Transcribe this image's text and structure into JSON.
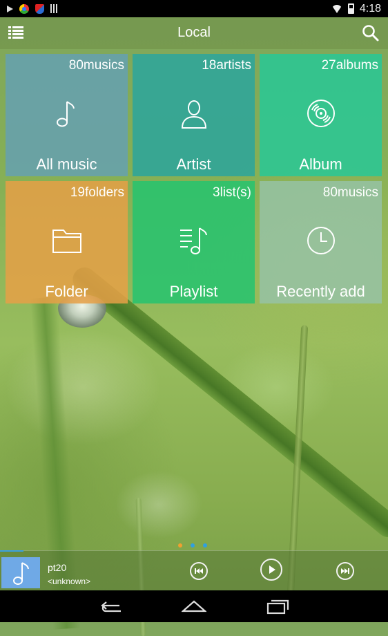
{
  "statusbar": {
    "time": "4:18"
  },
  "header": {
    "title": "Local"
  },
  "tiles": [
    {
      "count": "80musics",
      "label": "All music",
      "icon": "music-note-icon"
    },
    {
      "count": "18artists",
      "label": "Artist",
      "icon": "person-icon"
    },
    {
      "count": "27albums",
      "label": "Album",
      "icon": "disc-icon"
    },
    {
      "count": "19folders",
      "label": "Folder",
      "icon": "folder-icon"
    },
    {
      "count": "3list(s)",
      "label": "Playlist",
      "icon": "playlist-icon"
    },
    {
      "count": "80musics",
      "label": "Recently add",
      "icon": "clock-icon"
    }
  ],
  "pager": {
    "dots": 3,
    "colors": [
      "#f0a030",
      "#30a0e0",
      "#30a0e0"
    ]
  },
  "player": {
    "title": "pt20",
    "artist": "<unknown>",
    "progress": 0.06
  },
  "colors": {
    "accent": "#3aa0e0",
    "cover": "#6fa9e6"
  }
}
